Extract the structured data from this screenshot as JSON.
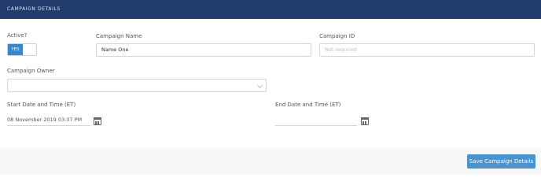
{
  "header": {
    "title": "CAMPAIGN DETAILS"
  },
  "fields": {
    "active": {
      "label": "Active?",
      "toggle_label": "YES"
    },
    "campaign_name": {
      "label": "Campaign Name",
      "value": "Name One"
    },
    "campaign_id": {
      "label": "Campaign ID",
      "placeholder": "Not required"
    },
    "campaign_owner": {
      "label": "Campaign Owner",
      "value": ""
    },
    "start_datetime": {
      "label": "Start Date and Time (ET)",
      "value": "08 November 2019 03:37 PM"
    },
    "end_datetime": {
      "label": "End Date and Time (ET)",
      "value": ""
    }
  },
  "actions": {
    "save_label": "Save Campaign Details"
  },
  "colors": {
    "header_bg": "#223c6e",
    "accent": "#3b86c4",
    "button": "#4a93cf"
  }
}
